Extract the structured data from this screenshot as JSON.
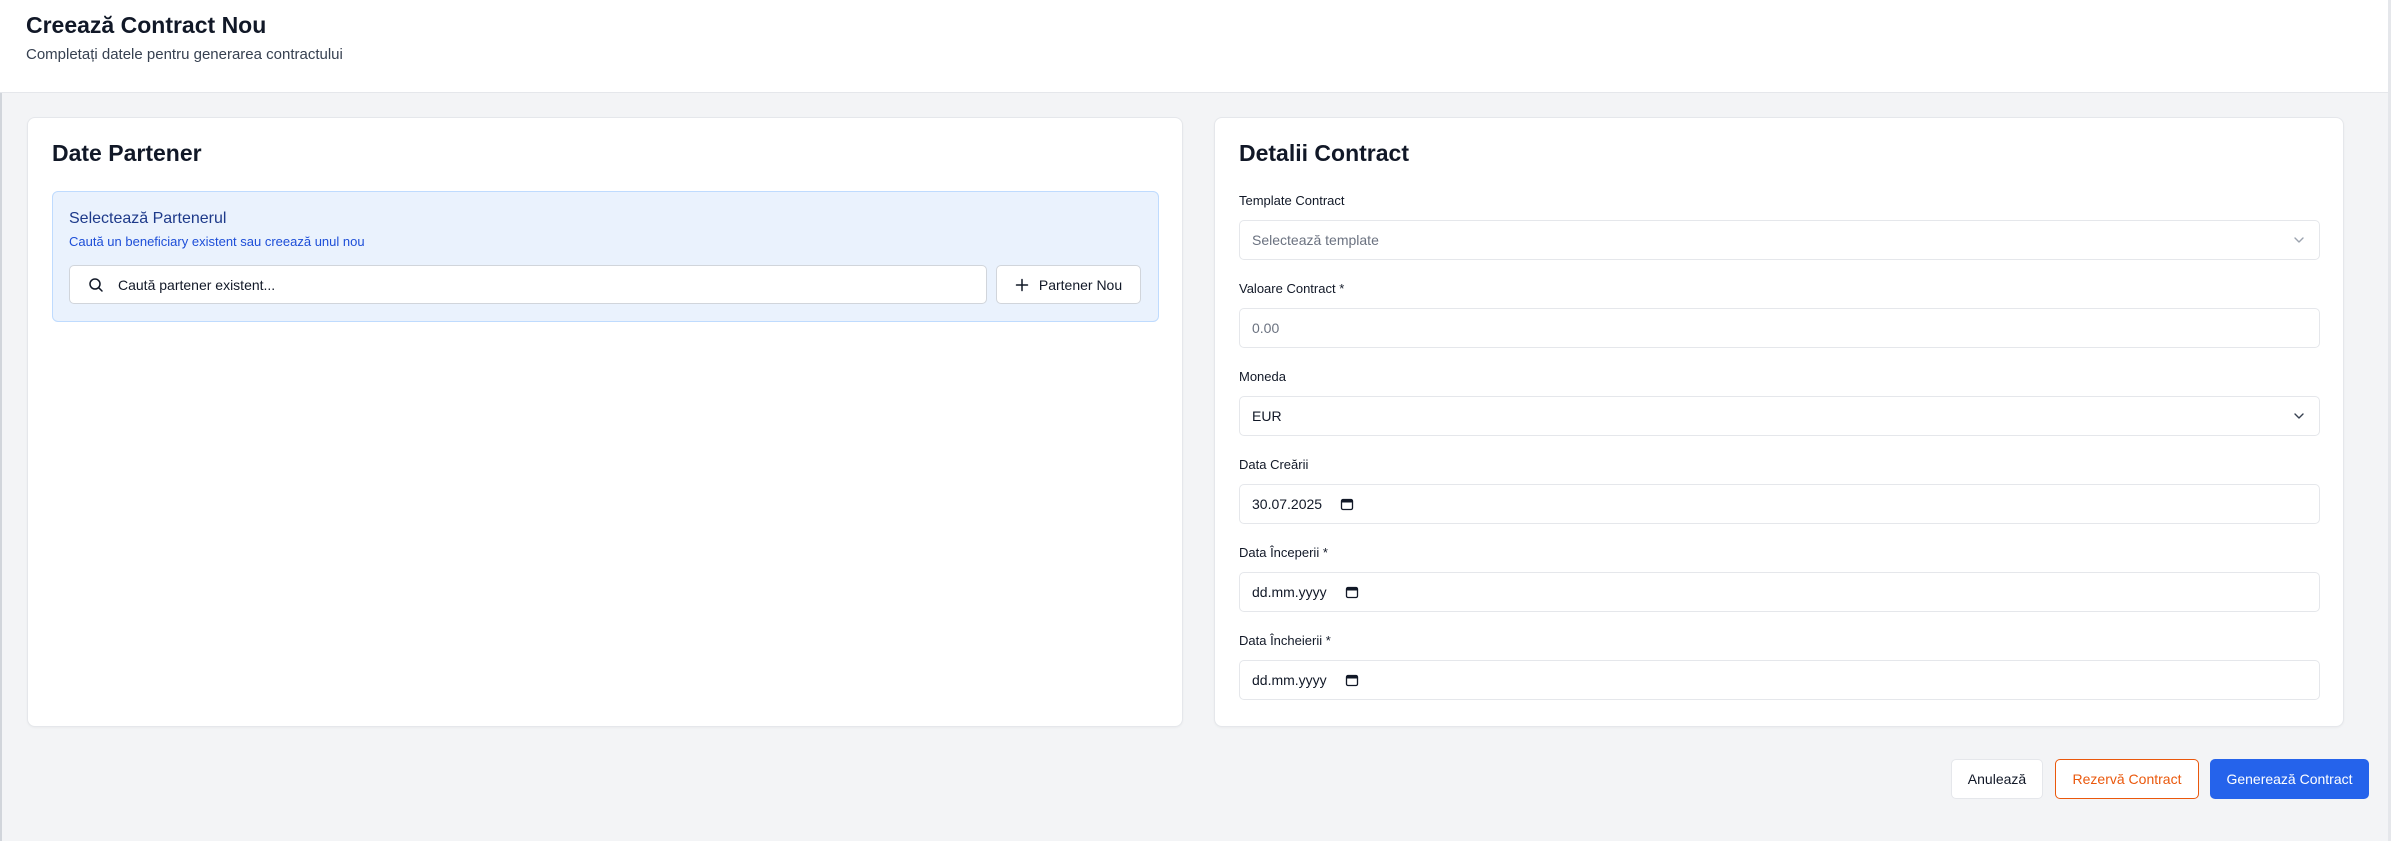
{
  "header": {
    "title": "Creează Contract Nou",
    "subtitle": "Completați datele pentru generarea contractului"
  },
  "partner_card": {
    "title": "Date Partener",
    "select_title": "Selectează Partenerul",
    "select_description": "Caută un beneficiary existent sau creează unul nou",
    "search_placeholder": "Caută partener existent...",
    "new_partner_label": "Partener Nou"
  },
  "contract_card": {
    "title": "Detalii Contract",
    "template_label": "Template Contract",
    "template_placeholder": "Selectează template",
    "value_label": "Valoare Contract *",
    "value_placeholder": "0.00",
    "currency_label": "Moneda",
    "currency_value": "EUR",
    "created_label": "Data Creării",
    "created_value": "30.07.2025",
    "start_label": "Data Începerii *",
    "start_value": "dd.mm.yyyy",
    "end_label": "Data Încheierii *",
    "end_value": "dd.mm.yyyy"
  },
  "footer": {
    "cancel_label": "Anulează",
    "reserve_label": "Rezervă Contract",
    "generate_label": "Generează Contract"
  },
  "colors": {
    "primary": "#2563eb",
    "reserve": "#ea580c",
    "info_bg": "#eaf2fd"
  },
  "icons": {
    "search": "search-icon",
    "plus": "plus-icon",
    "chevron": "chevron-down-icon",
    "calendar": "calendar-icon"
  }
}
